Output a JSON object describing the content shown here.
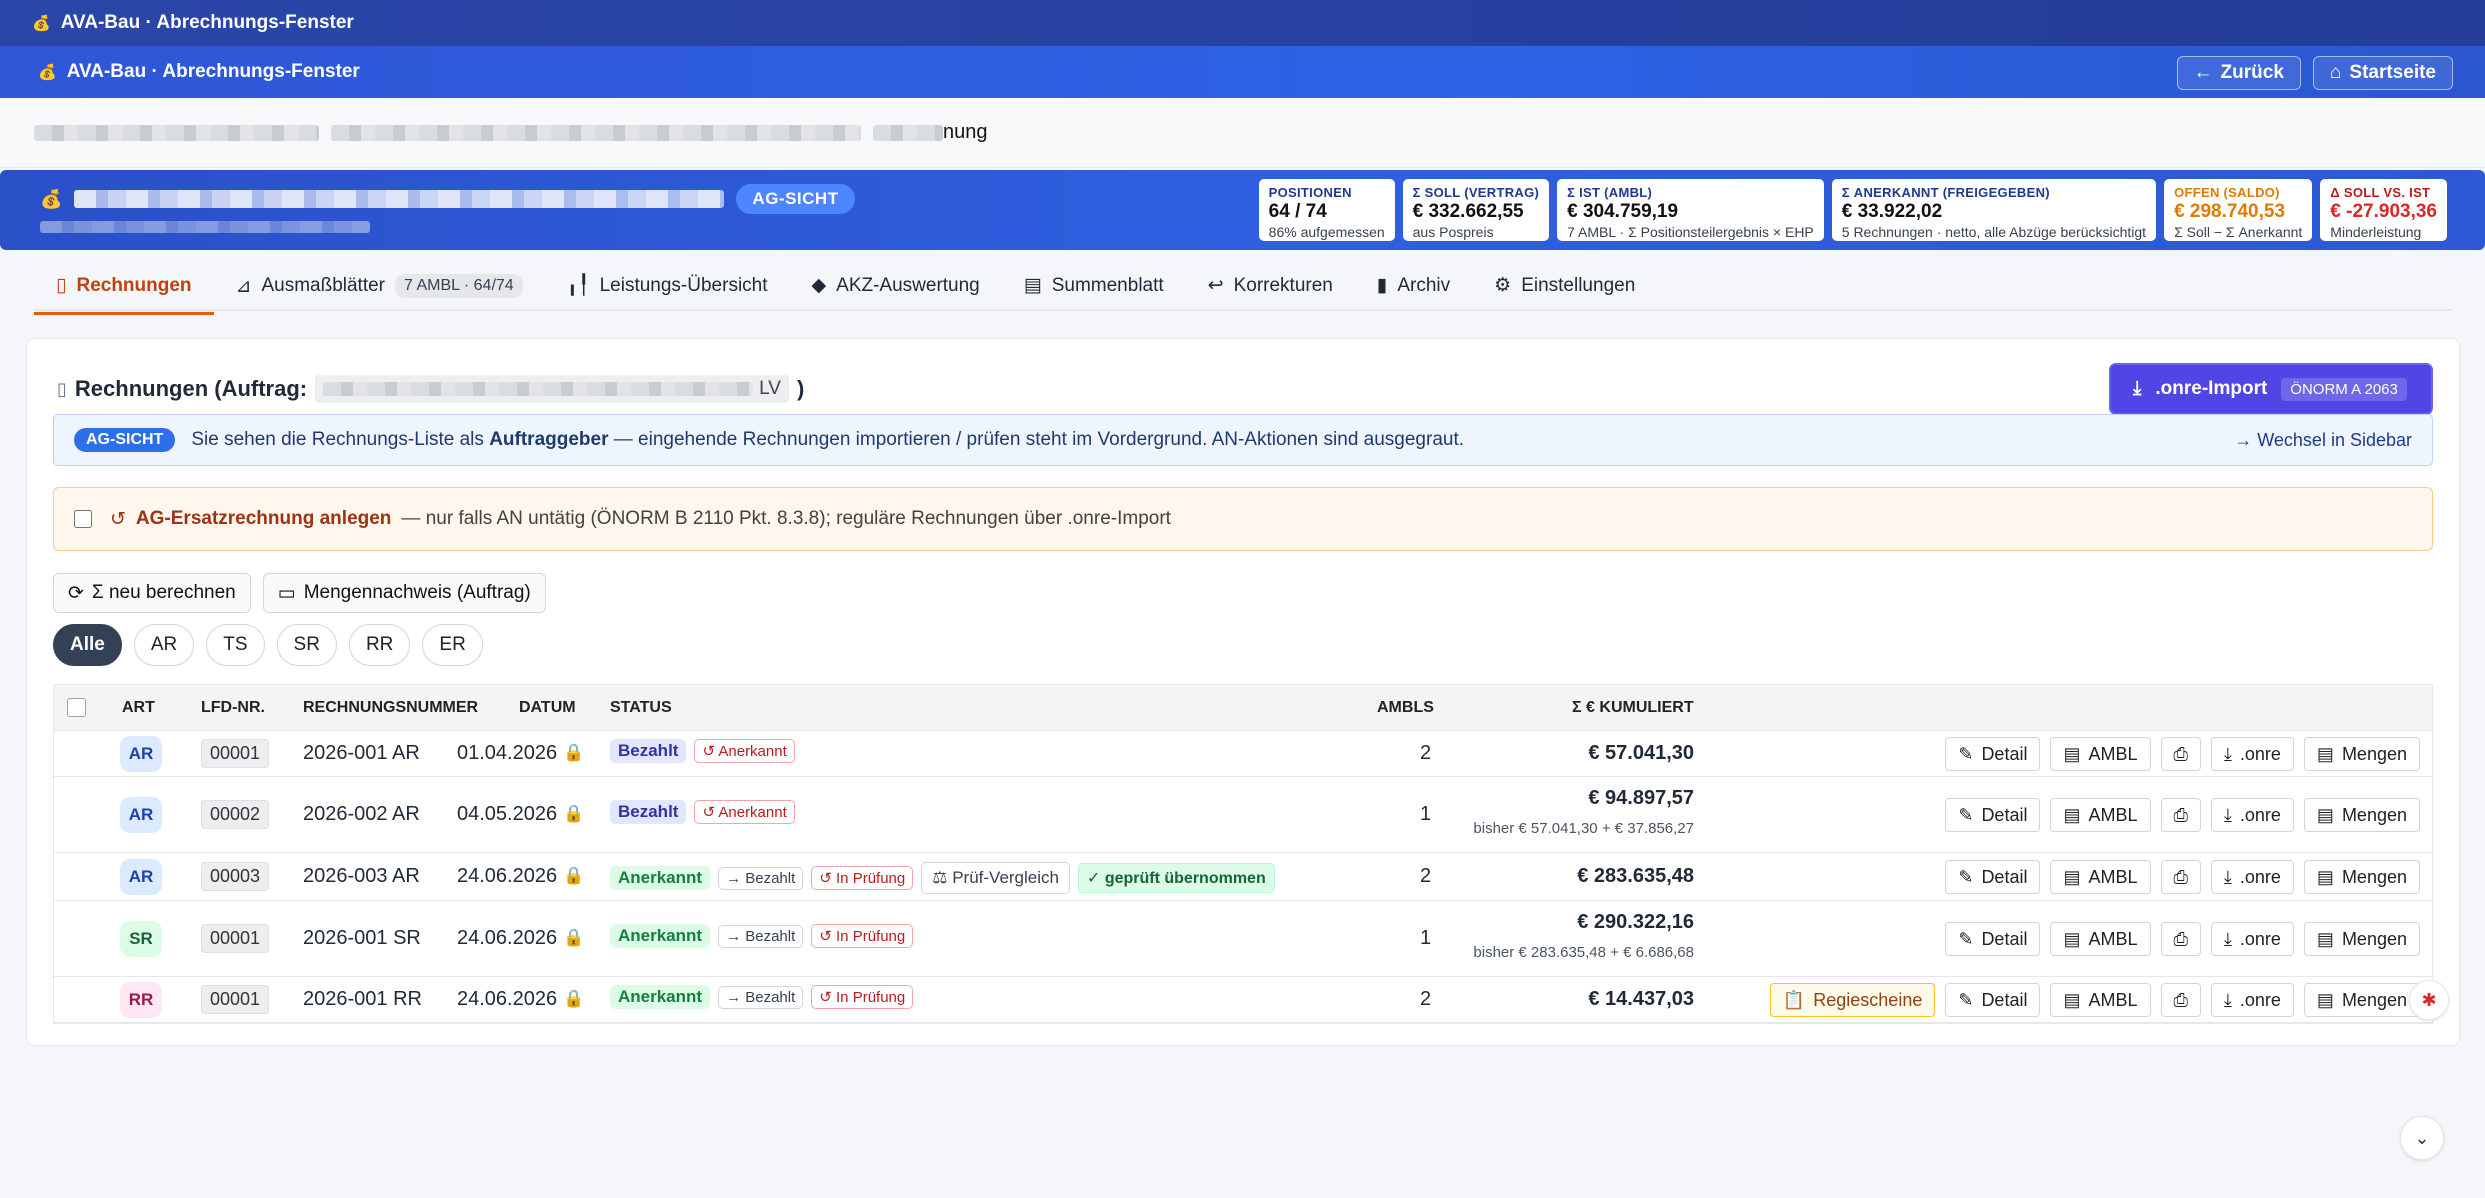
{
  "window": {
    "title": "AVA-Bau · Abrechnungs-Fenster"
  },
  "appbar": {
    "title": "AVA-Bau · Abrechnungs-Fenster",
    "back_label": "Zurück",
    "home_label": "Startseite"
  },
  "breadcrumb": {
    "visible_suffix": "nung"
  },
  "banner": {
    "badge": "AG-SICHT",
    "kpis": [
      {
        "key": "POSITIONEN",
        "value": "64 / 74",
        "sub": "86% aufgemessen",
        "tone": "normal"
      },
      {
        "key": "Σ SOLL (VERTRAG)",
        "value": "€ 332.662,55",
        "sub": "aus Pospreis",
        "tone": "normal"
      },
      {
        "key": "Σ IST (AMBL)",
        "value": "€ 304.759,19",
        "sub": "7 AMBL · Σ Positionsteilergebnis × EHP",
        "tone": "normal"
      },
      {
        "key": "Σ ANERKANNT (FREIGEGEBEN)",
        "value": "€ 33.922,02",
        "sub": "5 Rechnungen · netto, alle Abzüge berücksichtigt",
        "tone": "normal"
      },
      {
        "key": "OFFEN (SALDO)",
        "value": "€ 298.740,53",
        "sub": "Σ Soll − Σ Anerkannt",
        "tone": "orange"
      },
      {
        "key": "Δ SOLL VS. IST",
        "value": "€ -27.903,36",
        "sub": "Minderleistung",
        "tone": "red"
      }
    ]
  },
  "tabs": [
    {
      "label": "Rechnungen",
      "active": true
    },
    {
      "label": "Ausmaßblätter",
      "pill": "7 AMBL · 64/74"
    },
    {
      "label": "Leistungs-Übersicht"
    },
    {
      "label": "AKZ-Auswertung"
    },
    {
      "label": "Summenblatt"
    },
    {
      "label": "Korrekturen"
    },
    {
      "label": "Archiv"
    },
    {
      "label": "Einstellungen"
    }
  ],
  "section": {
    "title_prefix": "Rechnungen (Auftrag:",
    "title_tag_suffix": "LV",
    "title_close": ")",
    "import_label": ".onre-Import",
    "import_norm": "ÖNORM A 2063"
  },
  "info": {
    "badge": "AG-SICHT",
    "text_a": "Sie sehen die Rechnungs-Liste als",
    "text_bold": "Auftraggeber",
    "text_b": "— eingehende Rechnungen importieren / prüfen steht im Vordergrund. AN-Aktionen sind ausgegraut.",
    "link": "→ Wechsel in Sidebar"
  },
  "warn": {
    "title": "AG-Ersatzrechnung anlegen",
    "text": "— nur falls AN untätig (ÖNORM B 2110 Pkt. 8.3.8); reguläre Rechnungen über .onre-Import"
  },
  "actions": {
    "recalc": "Σ neu berechnen",
    "mengen": "Mengennachweis (Auftrag)"
  },
  "filters": [
    "Alle",
    "AR",
    "TS",
    "SR",
    "RR",
    "ER"
  ],
  "table": {
    "headers": {
      "art": "ART",
      "lfd": "LFD-NR.",
      "nr": "RECHNUNGSNUMMER",
      "datum": "DATUM",
      "status": "STATUS",
      "ambls": "AMBLS",
      "sum": "Σ € KUMULIERT"
    },
    "buttons": {
      "detail": "Detail",
      "ambl": "AMBL",
      "onre": ".onre",
      "mengen": "Mengen",
      "regie": "Regiescheine",
      "pruef": "Prüf-Vergleich",
      "geprueft": "✓ geprüft übernommen"
    },
    "rows": [
      {
        "art": "AR",
        "lfd": "00001",
        "nr": "2026-001 AR",
        "datum": "01.04.2026",
        "status": "Bezahlt",
        "chips": [
          "↺ Anerkannt"
        ],
        "ambls": "2",
        "sum": "€ 57.041,30",
        "hint": ""
      },
      {
        "art": "AR",
        "lfd": "00002",
        "nr": "2026-002 AR",
        "datum": "04.05.2026",
        "status": "Bezahlt",
        "chips": [
          "↺ Anerkannt"
        ],
        "ambls": "1",
        "sum": "€ 94.897,57",
        "hint": "bisher € 57.041,30 + € 37.856,27"
      },
      {
        "art": "AR",
        "lfd": "00003",
        "nr": "2026-003 AR",
        "datum": "24.06.2026",
        "status": "Anerkannt",
        "chips": [
          "→ Bezahlt",
          "↺ In Prüfung"
        ],
        "ambls": "2",
        "sum": "€ 283.635,48",
        "hint": ""
      },
      {
        "art": "SR",
        "lfd": "00001",
        "nr": "2026-001 SR",
        "datum": "24.06.2026",
        "status": "Anerkannt",
        "chips": [
          "→ Bezahlt",
          "↺ In Prüfung"
        ],
        "ambls": "1",
        "sum": "€ 290.322,16",
        "hint": "bisher € 283.635,48 + € 6.686,68"
      },
      {
        "art": "RR",
        "lfd": "00001",
        "nr": "2026-001 RR",
        "datum": "24.06.2026",
        "status": "Anerkannt",
        "chips": [
          "→ Bezahlt",
          "↺ In Prüfung"
        ],
        "ambls": "2",
        "sum": "€ 14.437,03",
        "hint": ""
      }
    ]
  }
}
